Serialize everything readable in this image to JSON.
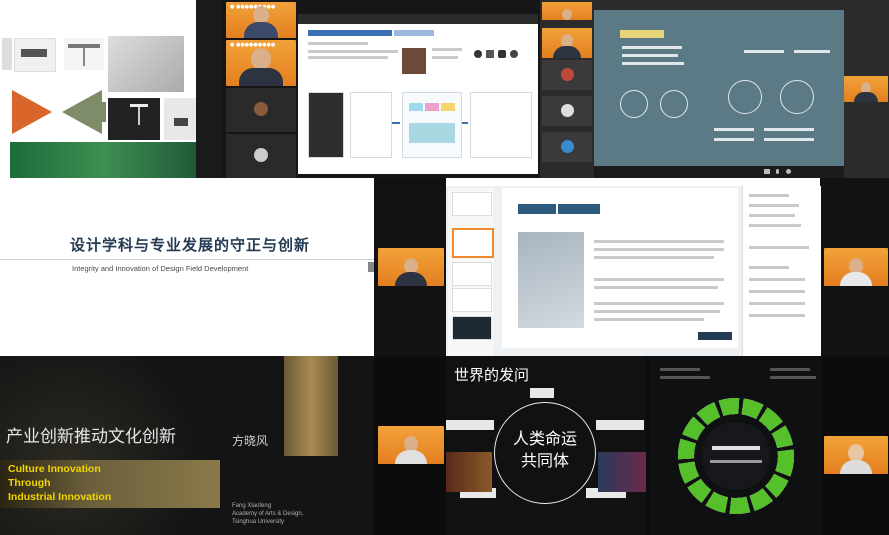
{
  "colors": {
    "accent_yellow": "#f2d600",
    "tile_orange": "#ee8a2a",
    "dark_bg": "#111111",
    "teal_bg": "#5b7a86",
    "navy": "#243b55"
  },
  "slide_center_left": {
    "title_cn": "设计学科与专业发展的守正与创新",
    "title_en": "Integrity and Innovation of Design Field Development"
  },
  "slide_bottom_left": {
    "title_cn": "产业创新推动文化创新",
    "title_en_lines": [
      "Culture Innovation",
      "Through",
      "Industrial Innovation"
    ],
    "speaker_cn": "方晓风",
    "speaker_en_lines": [
      "Fang Xiaofeng",
      "Academy of Arts & Design,",
      "Tsinghua University"
    ]
  },
  "slide_bottom_right": {
    "heading": "世界的发问",
    "center_line1": "人类命运",
    "center_line2": "共同体"
  },
  "icons": [
    "video-icon",
    "mic-icon",
    "settings-icon"
  ]
}
